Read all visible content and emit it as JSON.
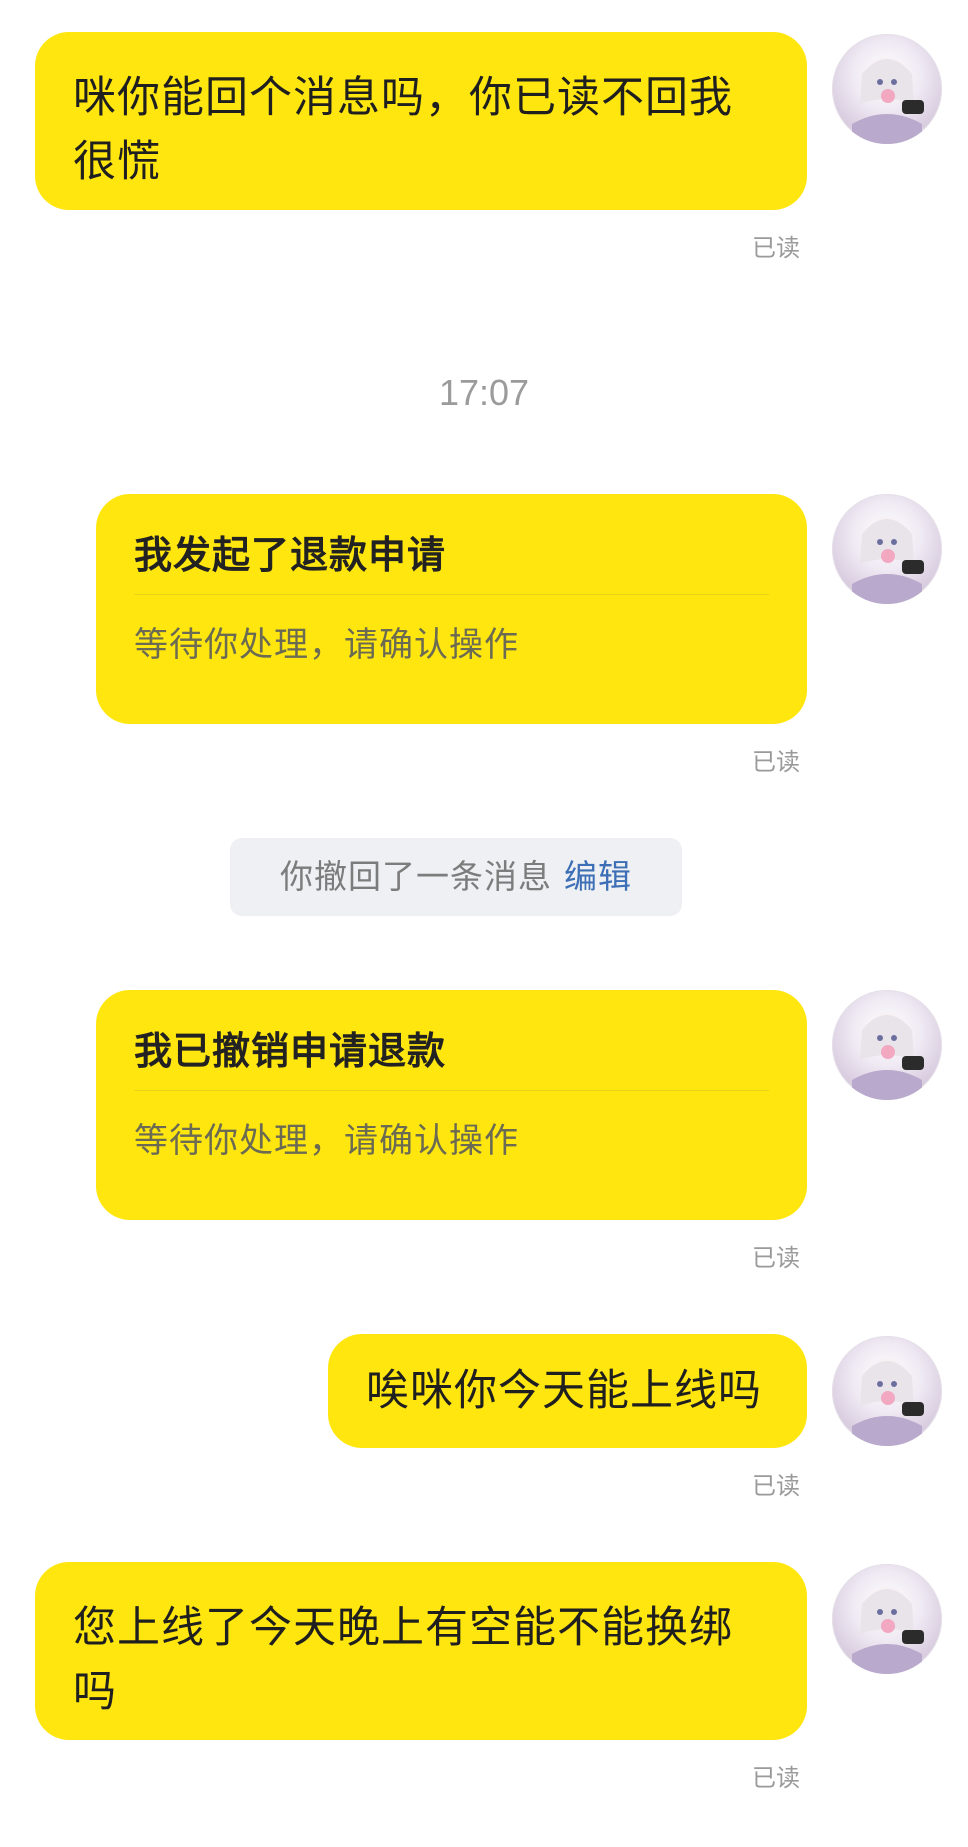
{
  "messages": [
    {
      "text": "咪你能回个消息吗，你已读不回我很慌",
      "status": "已读"
    },
    {
      "title": "我发起了退款申请",
      "subtitle": "等待你处理，请确认操作",
      "status": "已读"
    },
    {
      "title": "我已撤销申请退款",
      "subtitle": "等待你处理，请确认操作",
      "status": "已读"
    },
    {
      "text": "唉咪你今天能上线吗",
      "status": "已读"
    },
    {
      "text": "您上线了今天晚上有空能不能换绑吗",
      "status": "已读"
    }
  ],
  "timestamp": "17:07",
  "system_notice": {
    "text": "你撤回了一条消息",
    "action": "编辑"
  },
  "colors": {
    "bubble": "#ffe60f",
    "link": "#3d6fb6",
    "pill_bg": "#eef0f3"
  }
}
